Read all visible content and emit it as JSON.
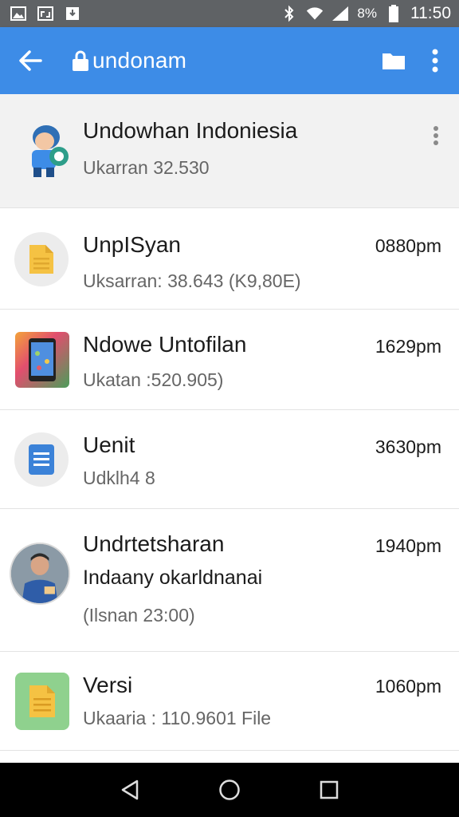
{
  "status_bar": {
    "battery_percent": "8%",
    "time": "11:50",
    "left_icons": [
      "gallery-icon",
      "screenshot-icon",
      "download-icon"
    ],
    "right_icons": [
      "bluetooth-icon",
      "wifi-icon",
      "signal-icon",
      "battery-icon"
    ]
  },
  "app_bar": {
    "title": "undonam",
    "back_icon": "arrow-back-icon",
    "lock_icon": "lock-icon",
    "folder_icon": "folder-icon",
    "more_icon": "more-vert-icon",
    "color": "#3d8ce7"
  },
  "header_item": {
    "title": "Undowhan Indoniesia",
    "subtitle": "Ukarran 32.530"
  },
  "items": [
    {
      "icon": "document-icon",
      "title": "UnpISyan",
      "subtitle": "Uksarran: 38.643 (K9,80E)",
      "time": "0880pm"
    },
    {
      "icon": "phone-app-icon",
      "title": "Ndowe Untofilan",
      "subtitle": "Ukatan :520.905)",
      "time": "1629pm"
    },
    {
      "icon": "doc-file-icon",
      "title": "Uenit",
      "subtitle": "Udklh4 8",
      "time": "3630pm"
    },
    {
      "icon": "contact-photo-icon",
      "title": "Undrtetsharan",
      "subtitle2": "Indaany okarldnanai",
      "subtitle": "(Ilsnan 23:00)",
      "time": "1940pm"
    },
    {
      "icon": "notes-file-icon",
      "title": "Versi",
      "subtitle": "Ukaaria : 110.9601 File",
      "time": "1060pm"
    }
  ],
  "nav_bar": {
    "back": "nav-back-icon",
    "home": "nav-home-icon",
    "recents": "nav-recents-icon"
  }
}
